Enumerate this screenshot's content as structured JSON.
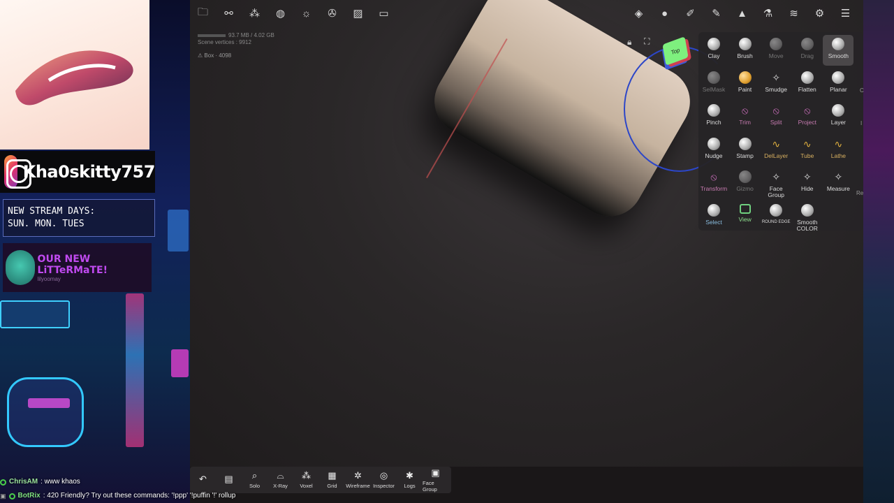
{
  "overlay": {
    "instagram_handle": "Kha0skitty757",
    "stream_days_title": "NEW STREAM DAYS:",
    "stream_days_value": "SUN. MON. TUES",
    "litter_title": "OUR NEW LiTTeRMaTE!",
    "litter_sub": "lilyoomay"
  },
  "chat": [
    {
      "name": "ChrisAM",
      "text": ": www khaos"
    },
    {
      "name": "BotRix",
      "text": ": 420 Friendly? Try out these commands: '!ppp' '!puffin '!' rollup"
    }
  ],
  "top_left_icons": [
    "folder-icon",
    "share-icon",
    "scene-icon",
    "material-icon",
    "light-icon",
    "post-process-icon",
    "background-image-icon",
    "camera-icon"
  ],
  "top_right_icons": [
    "interface-icon",
    "matcap-icon",
    "brush-settings-icon",
    "paint-icon",
    "topology-icon",
    "flask-icon",
    "layers-icon",
    "settings-icon",
    "menu-icon"
  ],
  "stats": {
    "memory": "93.7 MB / 4.02 GB",
    "scene_vertices": "Scene vertices : 9912",
    "mesh": "Box · 4098"
  },
  "viewcube": {
    "face_label": "Top"
  },
  "tools": [
    {
      "label": "Clay",
      "style": ""
    },
    {
      "label": "Brush",
      "style": ""
    },
    {
      "label": "Move",
      "style": "dim"
    },
    {
      "label": "Drag",
      "style": "dim"
    },
    {
      "label": "Smooth",
      "style": "active"
    },
    {
      "label": "SelMask",
      "style": "dim"
    },
    {
      "label": "Paint",
      "style": "paint"
    },
    {
      "label": "Smudge",
      "style": "plain"
    },
    {
      "label": "Flatten",
      "style": ""
    },
    {
      "label": "Planar",
      "style": ""
    },
    {
      "label": "Pinch",
      "style": ""
    },
    {
      "label": "Trim",
      "style": "pink"
    },
    {
      "label": "Split",
      "style": "pink"
    },
    {
      "label": "Project",
      "style": "pink"
    },
    {
      "label": "Layer",
      "style": ""
    },
    {
      "label": "Nudge",
      "style": ""
    },
    {
      "label": "Stamp",
      "style": ""
    },
    {
      "label": "DelLayer",
      "style": "gold"
    },
    {
      "label": "Tube",
      "style": "gold"
    },
    {
      "label": "Lathe",
      "style": "gold"
    },
    {
      "label": "Transform",
      "style": "pink"
    },
    {
      "label": "Gizmo",
      "style": "dim"
    },
    {
      "label": "Face Group",
      "style": "plain"
    },
    {
      "label": "Hide",
      "style": "plain"
    },
    {
      "label": "Measure",
      "style": "plain"
    },
    {
      "label": "Select",
      "style": "blue"
    },
    {
      "label": "View",
      "style": "green"
    },
    {
      "label": "ROUND EDGE",
      "style": "small"
    },
    {
      "label": "Smooth COLOR",
      "style": ""
    }
  ],
  "panel_edge_labels": [
    "C",
    "I",
    "Re"
  ],
  "bottom_bar": [
    {
      "label": "",
      "icon": "undo-icon"
    },
    {
      "label": "",
      "icon": "document-icon"
    },
    {
      "label": "Solo",
      "icon": "search-icon"
    },
    {
      "label": "X-Ray",
      "icon": "glasses-icon"
    },
    {
      "label": "Voxel",
      "icon": "voxel-icon"
    },
    {
      "label": "Grid",
      "icon": "grid-icon"
    },
    {
      "label": "Wireframe",
      "icon": "wireframe-icon"
    },
    {
      "label": "Inspector",
      "icon": "inspector-icon"
    },
    {
      "label": "Logs",
      "icon": "bug-icon"
    },
    {
      "label": "Face Group",
      "icon": "face-group-icon"
    }
  ]
}
